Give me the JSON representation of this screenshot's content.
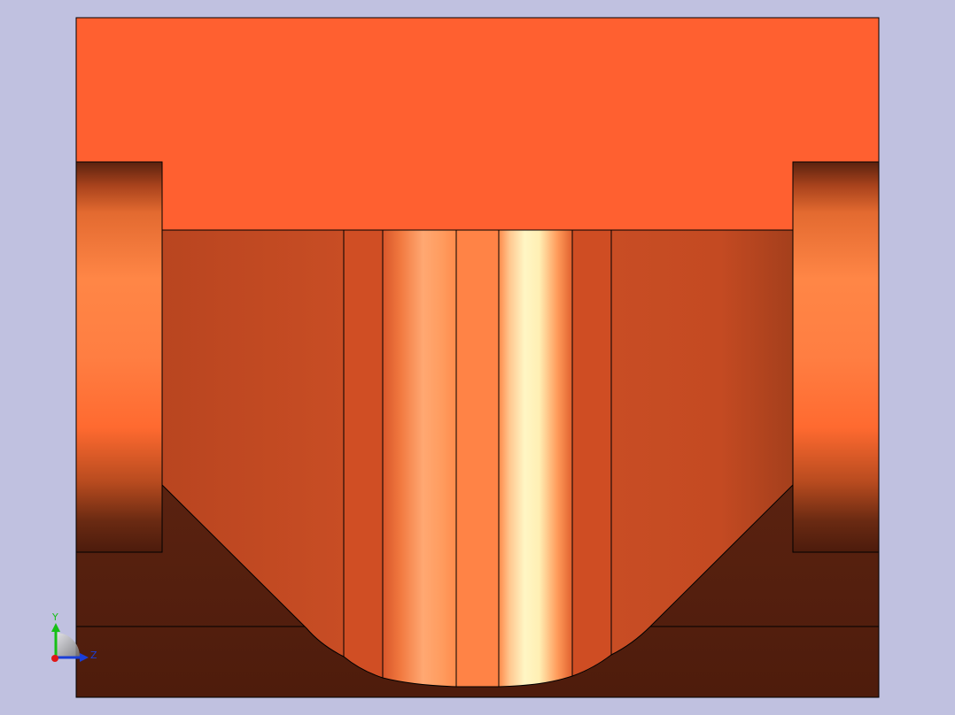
{
  "viewport": {
    "background_color": "#c0c1e0",
    "model_color": "#ff6030"
  },
  "triad": {
    "y_label": "Y",
    "z_label": "Z",
    "y_color": "#16c016",
    "z_color": "#1a3ed8",
    "x_color": "#e01818"
  }
}
